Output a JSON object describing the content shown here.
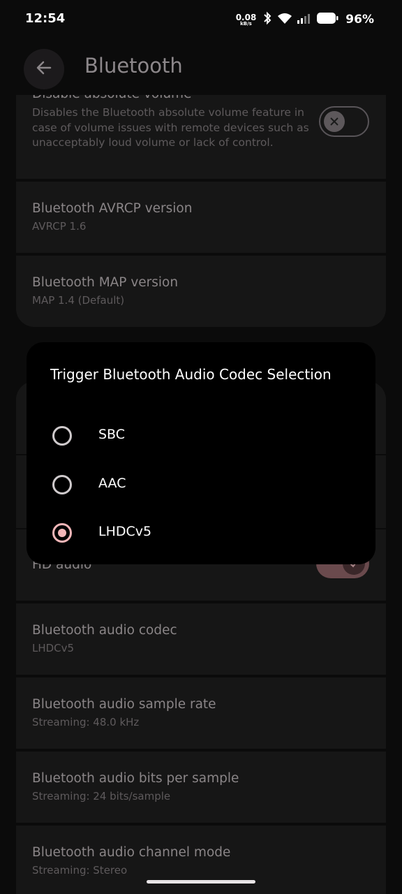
{
  "status_bar": {
    "time": "12:54",
    "net_speed_value": "0.08",
    "net_speed_unit": "kB/s",
    "battery_percent": "96%",
    "icons": [
      "bluetooth-icon",
      "wifi-icon",
      "signal-icon",
      "battery-icon"
    ]
  },
  "header": {
    "title": "Bluetooth",
    "back_icon": "arrow-left-icon"
  },
  "settings_top": [
    {
      "title": "Disable absolute volume",
      "subtitle": "Disables the Bluetooth absolute volume feature in case of volume issues with remote devices such as unacceptably loud volume or lack of control.",
      "toggle": "off"
    },
    {
      "title": "Bluetooth AVRCP version",
      "subtitle": "AVRCP 1.6"
    },
    {
      "title": "Bluetooth MAP version",
      "subtitle": "MAP 1.4 (Default)"
    }
  ],
  "settings_bottom": [
    {
      "title": "HD audio",
      "toggle": "on"
    },
    {
      "title": "Bluetooth audio codec",
      "subtitle": "LHDCv5"
    },
    {
      "title": "Bluetooth audio sample rate",
      "subtitle": "Streaming: 48.0 kHz"
    },
    {
      "title": "Bluetooth audio bits per sample",
      "subtitle": "Streaming: 24 bits/sample"
    },
    {
      "title": "Bluetooth audio channel mode",
      "subtitle": "Streaming: Stereo"
    }
  ],
  "dialog": {
    "title": "Trigger Bluetooth Audio Codec Selection",
    "options": [
      {
        "label": "SBC",
        "selected": false
      },
      {
        "label": "AAC",
        "selected": false
      },
      {
        "label": "LHDCv5",
        "selected": true
      }
    ]
  },
  "colors": {
    "background": "#0b0b0b",
    "card": "#161616",
    "dialog": "#000000",
    "accent": "#f2b6b8",
    "toggle_on": "#6a4a4d"
  }
}
